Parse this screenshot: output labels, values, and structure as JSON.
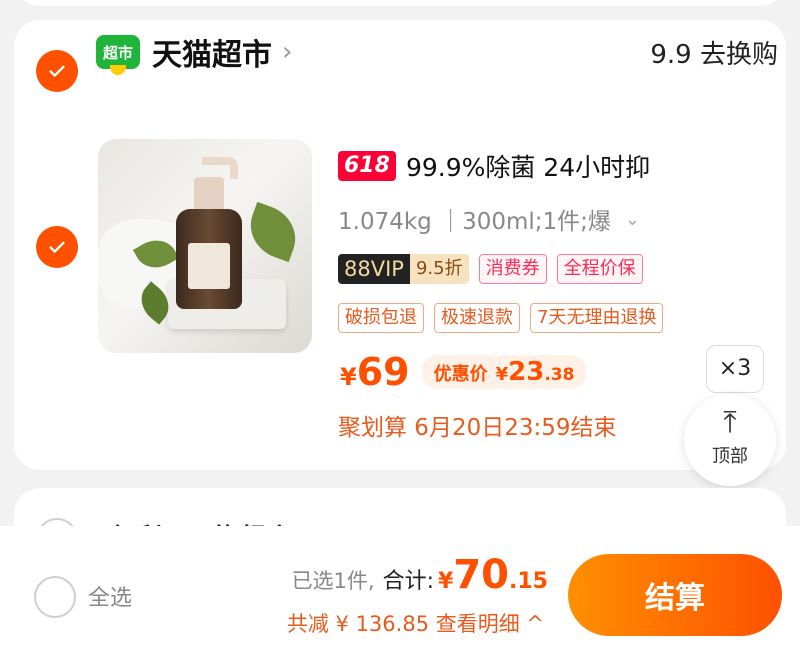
{
  "store": {
    "logo_text": "超市",
    "name": "天猫超市",
    "chevron": "›",
    "swap_label": "9.9 去换购"
  },
  "product": {
    "badge_618": "618",
    "title": "99.9%除菌 24小时抑",
    "spec": "1.074kg ｜300ml;1件;爆",
    "spec_caret": "⌄",
    "vip_label": "88VIP",
    "vip_discount": "9.5折",
    "tags_promo": [
      "消费券",
      "全程价保"
    ],
    "tags_service": [
      "破损包退",
      "极速退款",
      "7天无理由退换"
    ],
    "price_symbol": "¥",
    "price": "69",
    "promo_label": "优惠价",
    "promo_symbol": "¥",
    "promo_int": "23",
    "promo_dec": ".38",
    "quantity": "×3",
    "deal_text": "聚划算 6月20日23:59结束"
  },
  "to_top": {
    "icon": "⤒",
    "label": "顶部"
  },
  "next_store": {
    "name": "何利日用旗舰店"
  },
  "bottom_bar": {
    "select_all": "全选",
    "selected": "已选1件,",
    "total_label": "合计:",
    "total_symbol": "¥",
    "total_int": "70",
    "total_dec": ".15",
    "savings": "共减 ¥ 136.85  查看明细 ^",
    "checkout": "结算"
  },
  "colors": {
    "accent": "#ff5000",
    "store_green": "#1fb43a",
    "badge_red": "#ff0036"
  }
}
